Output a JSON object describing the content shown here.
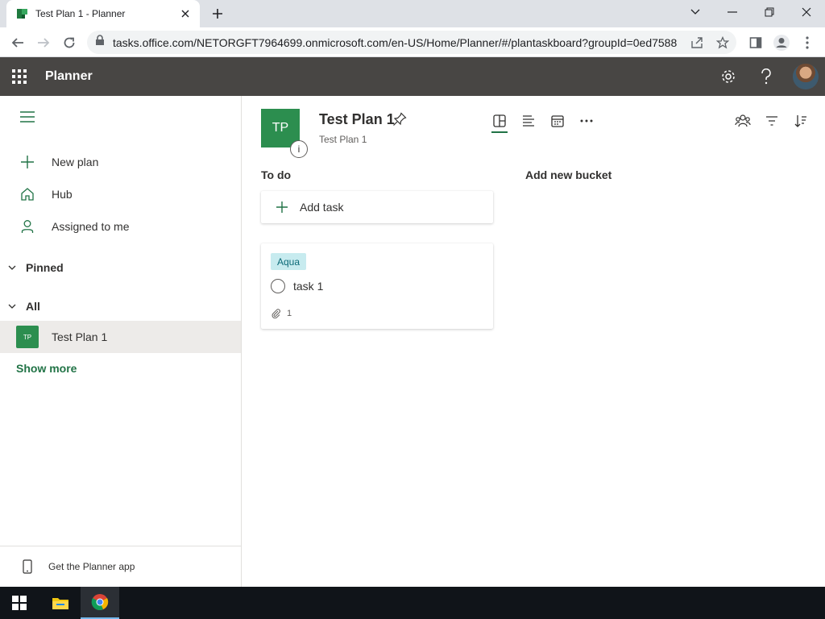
{
  "browser": {
    "tab_title": "Test Plan 1 - Planner",
    "url": "tasks.office.com/NETORGFT7964699.onmicrosoft.com/en-US/Home/Planner/#/plantaskboard?groupId=0ed7588...",
    "icons": [
      "planner-favicon",
      "close-icon",
      "plus-icon",
      "chevron-down-icon",
      "minimize-icon",
      "restore-icon",
      "close-icon",
      "back-icon",
      "forward-icon",
      "reload-icon",
      "lock-icon",
      "share-icon",
      "star-icon",
      "sidepanel-icon",
      "profile-icon",
      "more-vertical-icon"
    ]
  },
  "appbar": {
    "app_name": "Planner",
    "icons": [
      "waffle-icon",
      "gear-icon",
      "help-icon",
      "avatar"
    ]
  },
  "leftnav": {
    "items": [
      {
        "label": "New plan",
        "icon": "plus-icon"
      },
      {
        "label": "Hub",
        "icon": "home-icon"
      },
      {
        "label": "Assigned to me",
        "icon": "person-icon"
      }
    ],
    "sections": [
      {
        "label": "Pinned"
      },
      {
        "label": "All"
      }
    ],
    "plan": {
      "badge": "TP",
      "label": "Test Plan 1"
    },
    "show_more": "Show more",
    "get_app": "Get the Planner app"
  },
  "main": {
    "plan_tile": "TP",
    "info": "i",
    "plan_title": "Test Plan 1",
    "plan_subtitle": "Test Plan 1",
    "bucket": "To do",
    "add_bucket": "Add new bucket",
    "add_task": "Add task",
    "task": {
      "label": "Aqua",
      "title": "task 1",
      "attachments": "1"
    }
  },
  "colors": {
    "brand_green": "#2c8e4f",
    "appbar": "#484644",
    "label_aqua": "#c7ebef"
  }
}
